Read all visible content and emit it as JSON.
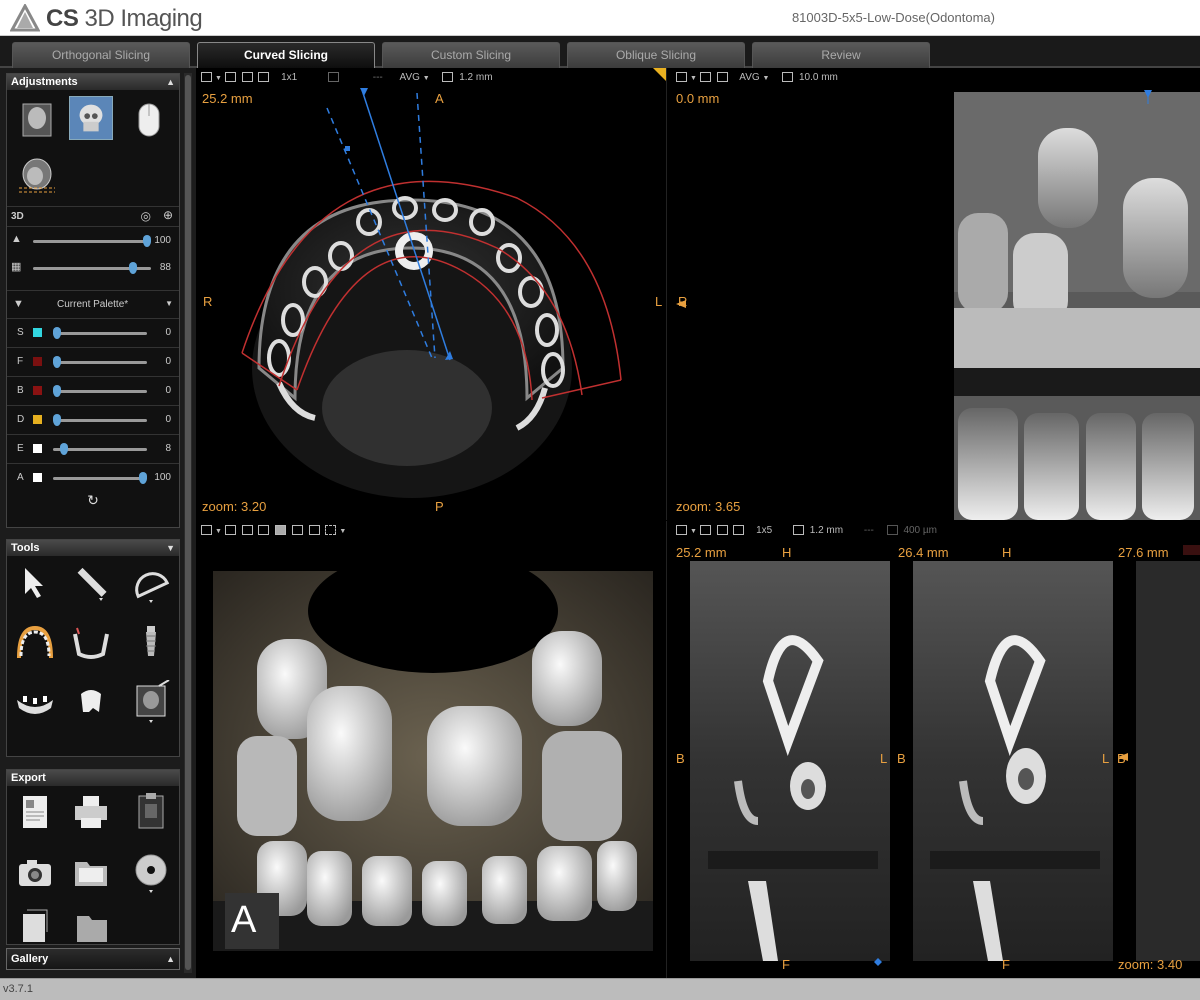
{
  "app": {
    "brand": "CS",
    "name": "3D Imaging",
    "document": "81003D-5x5-Low-Dose(Odontoma)",
    "version": "v3.7.1"
  },
  "tabs": [
    {
      "label": "Orthogonal Slicing",
      "active": false
    },
    {
      "label": "Curved Slicing",
      "active": true
    },
    {
      "label": "Custom Slicing",
      "active": false
    },
    {
      "label": "Oblique Slicing",
      "active": false
    },
    {
      "label": "Review",
      "active": false
    }
  ],
  "adjustments": {
    "title": "Adjustments",
    "section3d": "3D",
    "sliders": [
      {
        "icon": "bone-density-icon",
        "value": "100",
        "level": 0.95
      },
      {
        "icon": "opacity-icon",
        "value": "88",
        "level": 0.82
      }
    ],
    "palette": "Current Palette*",
    "channels": [
      {
        "key": "S",
        "color": "#32d6e0",
        "value": "0",
        "level": 0.0
      },
      {
        "key": "F",
        "color": "#7a1010",
        "value": "0",
        "level": 0.0
      },
      {
        "key": "B",
        "color": "#8a1212",
        "value": "0",
        "level": 0.0
      },
      {
        "key": "D",
        "color": "#e6b020",
        "value": "0",
        "level": 0.0
      },
      {
        "key": "E",
        "color": "#ffffff",
        "value": "8",
        "level": 0.08
      },
      {
        "key": "A",
        "color": "#ffffff",
        "value": "100",
        "level": 1.0
      }
    ]
  },
  "tools": {
    "title": "Tools"
  },
  "export": {
    "title": "Export"
  },
  "gallery": {
    "title": "Gallery"
  },
  "axial": {
    "toolbar": {
      "mode": "1x1",
      "dash": "---",
      "avg": "AVG",
      "thickness": "1.2 mm"
    },
    "pos": "25.2 mm",
    "top": "A",
    "left": "R",
    "right": "L",
    "bottom": "P",
    "zoom": "zoom: 3.20"
  },
  "pano": {
    "toolbar": {
      "avg": "AVG",
      "thickness": "10.0 mm"
    },
    "pos": "0.0 mm",
    "left": "R",
    "zoom": "zoom: 3.65"
  },
  "volume": {
    "label": "A"
  },
  "cross": {
    "toolbar": {
      "mode": "1x5",
      "thickness": "1.2 mm",
      "dash": "---",
      "spacing": "400 µm"
    },
    "slices": [
      {
        "pos": "25.2 mm",
        "top": "H",
        "left": "B",
        "right": "L",
        "bottom": "F"
      },
      {
        "pos": "26.4 mm",
        "top": "H",
        "left": "B",
        "right": "L",
        "bottom": "F"
      },
      {
        "pos": "27.6 mm",
        "left": "B"
      }
    ],
    "zoom": "zoom: 3.40"
  }
}
